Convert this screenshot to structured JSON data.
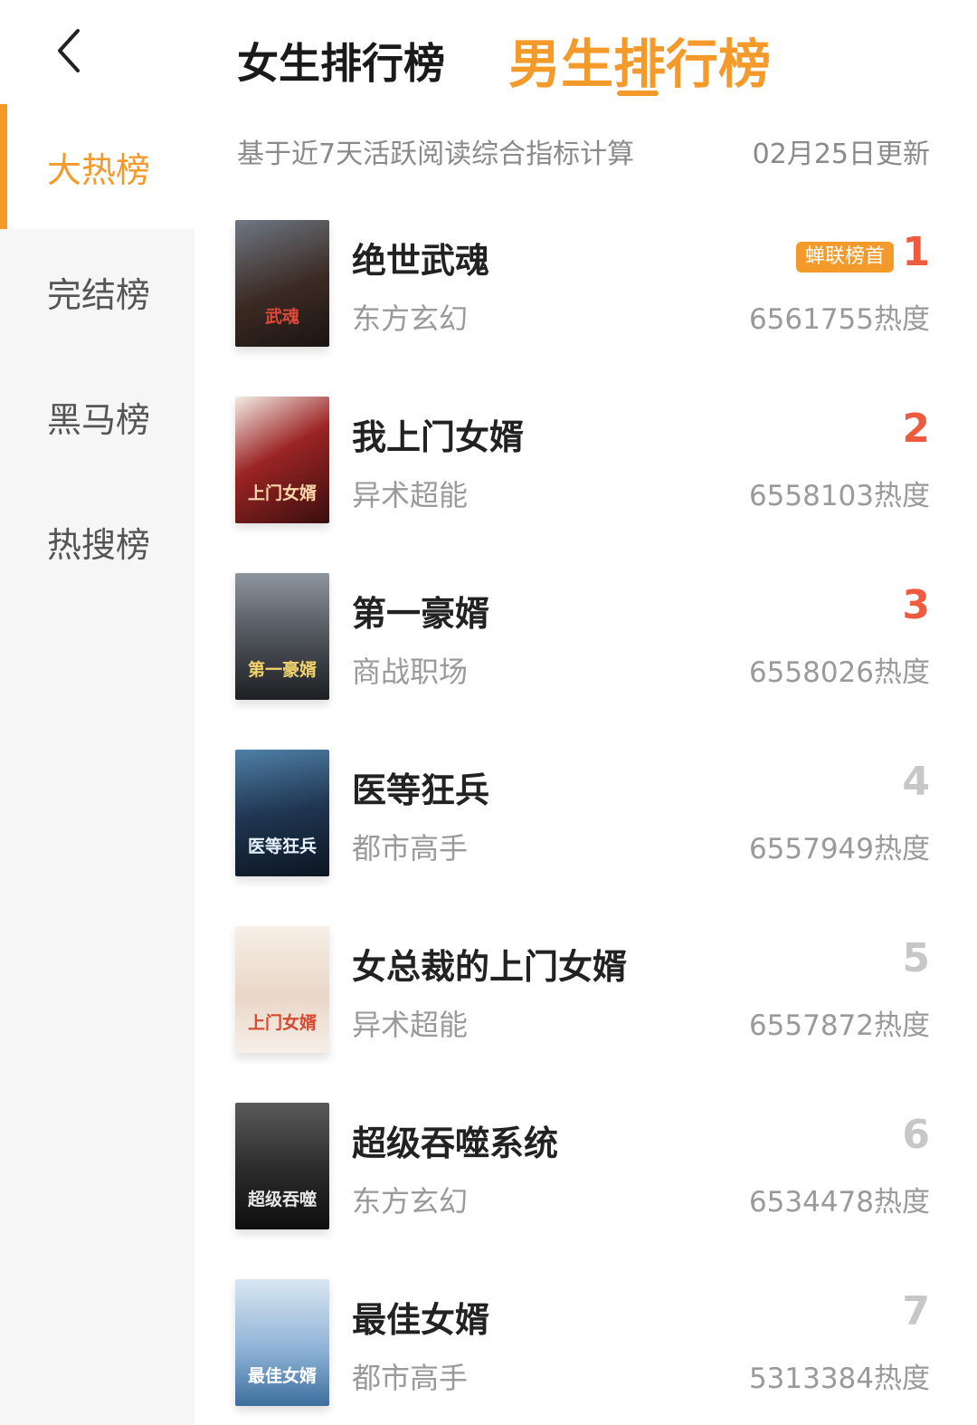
{
  "header": {
    "tabs": [
      {
        "label": "女生排行榜",
        "active": false
      },
      {
        "label": "男生排行榜",
        "active": true
      }
    ],
    "active_color": "#f39a2b"
  },
  "sidebar": {
    "items": [
      {
        "label": "大热榜",
        "active": true
      },
      {
        "label": "完结榜",
        "active": false
      },
      {
        "label": "黑马榜",
        "active": false
      },
      {
        "label": "热搜榜",
        "active": false
      }
    ]
  },
  "list": {
    "description": "基于近7天活跃阅读综合指标计算",
    "updated": "02月25日更新",
    "books": [
      {
        "title": "绝世武魂",
        "genre": "东方玄幻",
        "rank": "1",
        "heat": "6561755热度",
        "badge": "蝉联榜首",
        "rank_color": "#ef5b3f",
        "cover_text": "武魂",
        "cover_bg": "#3b2a23"
      },
      {
        "title": "我上门女婿",
        "genre": "异术超能",
        "rank": "2",
        "heat": "6558103热度",
        "badge": "",
        "rank_color": "#ef5b3f",
        "cover_text": "上门女婿",
        "cover_bg": "#6a1a1a"
      },
      {
        "title": "第一豪婿",
        "genre": "商战职场",
        "rank": "3",
        "heat": "6558026热度",
        "badge": "",
        "rank_color": "#ef5b3f",
        "cover_text": "第一豪婿",
        "cover_bg": "#4a4e55"
      },
      {
        "title": "医等狂兵",
        "genre": "都市高手",
        "rank": "4",
        "heat": "6557949热度",
        "badge": "",
        "rank_color": "#c7c7c7",
        "cover_text": "医等狂兵",
        "cover_bg": "#1f3550"
      },
      {
        "title": "女总裁的上门女婿",
        "genre": "异术超能",
        "rank": "5",
        "heat": "6557872热度",
        "badge": "",
        "rank_color": "#c7c7c7",
        "cover_text": "上门女婿",
        "cover_bg": "#f2e6dd"
      },
      {
        "title": "超级吞噬系统",
        "genre": "东方玄幻",
        "rank": "6",
        "heat": "6534478热度",
        "badge": "",
        "rank_color": "#c7c7c7",
        "cover_text": "超级吞噬",
        "cover_bg": "#2a2a2a"
      },
      {
        "title": "最佳女婿",
        "genre": "都市高手",
        "rank": "7",
        "heat": "5313384热度",
        "badge": "",
        "rank_color": "#c7c7c7",
        "cover_text": "最佳女婿",
        "cover_bg": "#8fb3d6"
      }
    ]
  }
}
